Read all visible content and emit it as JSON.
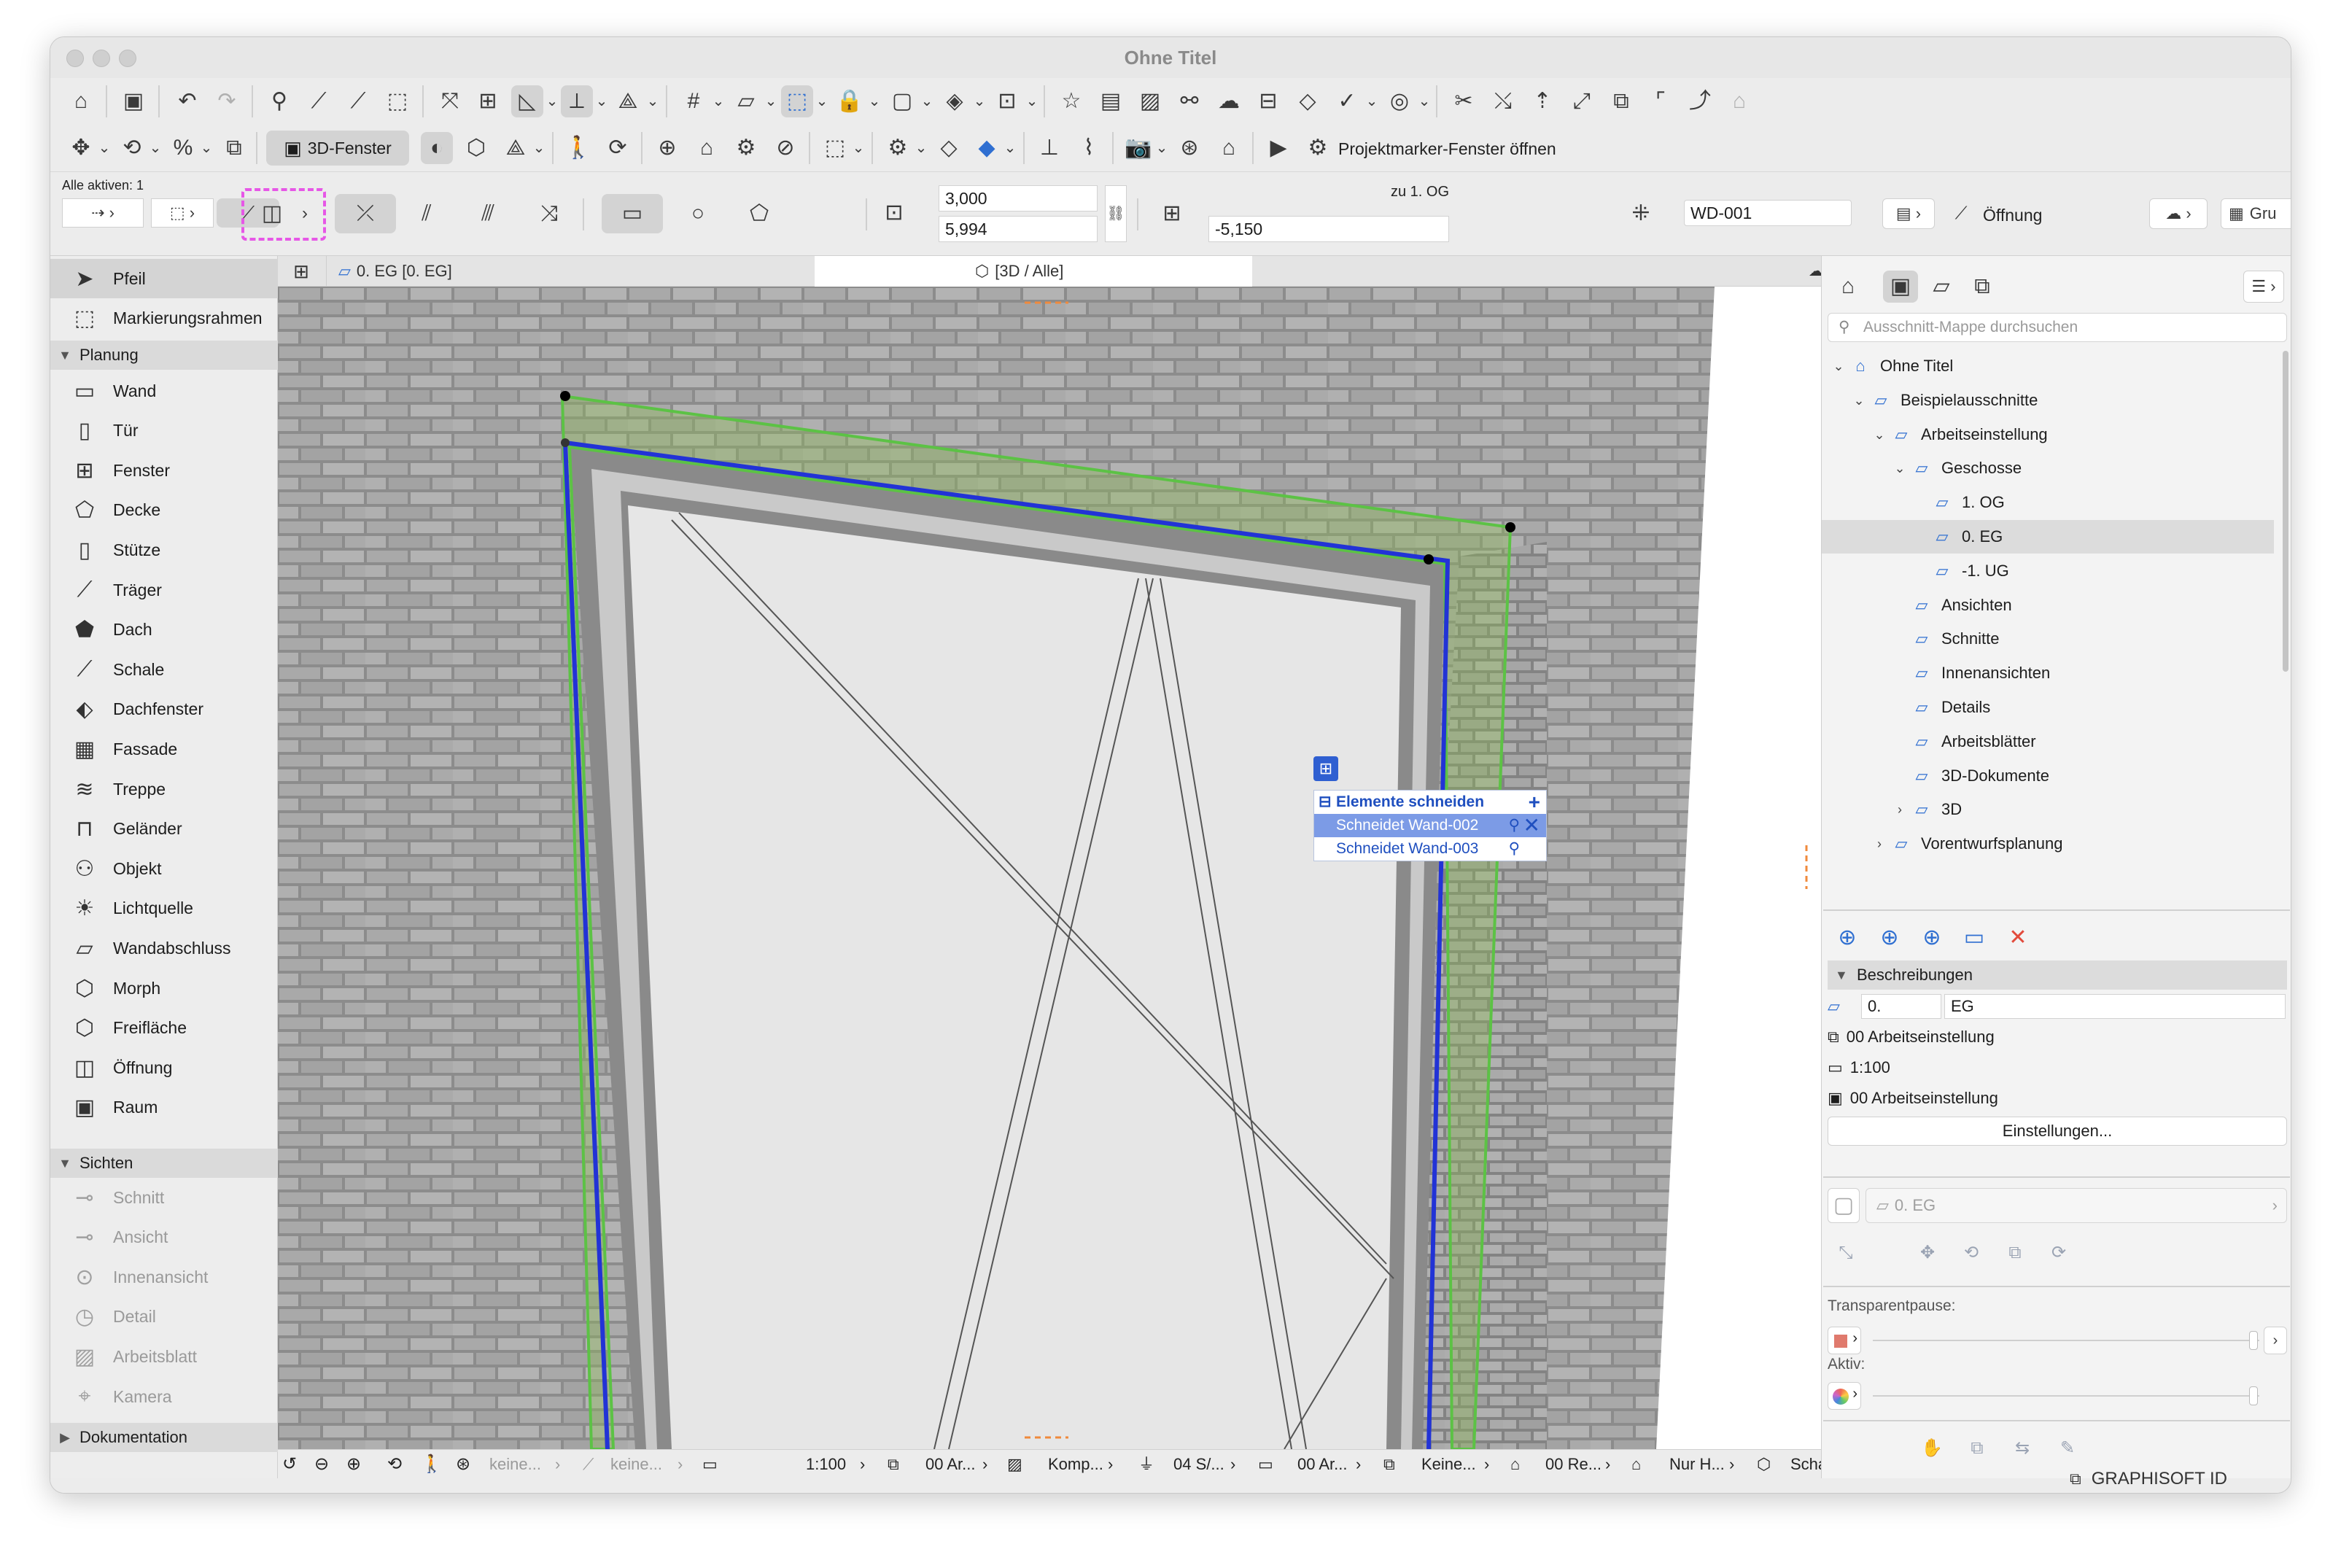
{
  "window": {
    "title": "Ohne Titel"
  },
  "toolbar2": {
    "window3d_label": "3D-Fenster",
    "marker_label": "Projektmarker-Fenster öffnen"
  },
  "infobox": {
    "all_active": "Alle aktiven: 1",
    "height1": "3,000",
    "height2": "5,994",
    "to_story": "zu 1. OG",
    "offset": "-5,150",
    "id": "WD-001",
    "element_type": "Öffnung",
    "group_label": "Gru"
  },
  "toolbox": {
    "top": [
      {
        "label": "Pfeil",
        "icon": "arrow-icon"
      },
      {
        "label": "Markierungsrahmen",
        "icon": "marquee-icon"
      }
    ],
    "sections": {
      "planung": "Planung",
      "sichten": "Sichten",
      "dokumentation": "Dokumentation"
    },
    "planung": [
      {
        "label": "Wand",
        "icon": "wall-icon"
      },
      {
        "label": "Tür",
        "icon": "door-icon"
      },
      {
        "label": "Fenster",
        "icon": "window-icon"
      },
      {
        "label": "Decke",
        "icon": "slab-icon"
      },
      {
        "label": "Stütze",
        "icon": "column-icon"
      },
      {
        "label": "Träger",
        "icon": "beam-icon"
      },
      {
        "label": "Dach",
        "icon": "roof-icon"
      },
      {
        "label": "Schale",
        "icon": "shell-icon"
      },
      {
        "label": "Dachfenster",
        "icon": "skylight-icon"
      },
      {
        "label": "Fassade",
        "icon": "curtainwall-icon"
      },
      {
        "label": "Treppe",
        "icon": "stair-icon"
      },
      {
        "label": "Geländer",
        "icon": "railing-icon"
      },
      {
        "label": "Objekt",
        "icon": "object-icon"
      },
      {
        "label": "Lichtquelle",
        "icon": "lamp-icon"
      },
      {
        "label": "Wandabschluss",
        "icon": "wallend-icon"
      },
      {
        "label": "Morph",
        "icon": "morph-icon"
      },
      {
        "label": "Freifläche",
        "icon": "mesh-icon"
      },
      {
        "label": "Öffnung",
        "icon": "opening-icon"
      },
      {
        "label": "Raum",
        "icon": "zone-icon"
      }
    ],
    "sichten": [
      {
        "label": "Schnitt",
        "icon": "section-icon"
      },
      {
        "label": "Ansicht",
        "icon": "elevation-icon"
      },
      {
        "label": "Innenansicht",
        "icon": "interior-elevation-icon"
      },
      {
        "label": "Detail",
        "icon": "detail-icon"
      },
      {
        "label": "Arbeitsblatt",
        "icon": "worksheet-icon"
      },
      {
        "label": "Kamera",
        "icon": "camera-icon"
      }
    ]
  },
  "tabs": [
    {
      "label": "0. EG [0. EG]"
    },
    {
      "label": "[3D / Alle]"
    }
  ],
  "cut_panel": {
    "title": "Elemente schneiden",
    "items": [
      "Schneidet Wand-002",
      "Schneidet Wand-003"
    ]
  },
  "statusbar": {
    "items": [
      "keine...",
      "keine...",
      "1:100",
      "00 Ar...",
      "Komp...",
      "04 S/...",
      "00 Ar...",
      "Keine...",
      "00 Re...",
      "Nur H...",
      "Schat..."
    ]
  },
  "navigator": {
    "search_placeholder": "Ausschnitt-Mappe durchsuchen",
    "tree": [
      {
        "label": "Ohne Titel",
        "level": 0,
        "chev": "⌄"
      },
      {
        "label": "Beispielausschnitte",
        "level": 1,
        "chev": "⌄"
      },
      {
        "label": "Arbeitseinstellung",
        "level": 2,
        "chev": "⌄"
      },
      {
        "label": "Geschosse",
        "level": 3,
        "chev": "⌄"
      },
      {
        "label": "1. OG",
        "level": 4,
        "chev": ""
      },
      {
        "label": "0. EG",
        "level": 4,
        "chev": "",
        "selected": true
      },
      {
        "label": "-1. UG",
        "level": 4,
        "chev": ""
      },
      {
        "label": "Ansichten",
        "level": 3,
        "chev": ""
      },
      {
        "label": "Schnitte",
        "level": 3,
        "chev": ""
      },
      {
        "label": "Innenansichten",
        "level": 3,
        "chev": ""
      },
      {
        "label": "Details",
        "level": 3,
        "chev": ""
      },
      {
        "label": "Arbeitsblätter",
        "level": 3,
        "chev": ""
      },
      {
        "label": "3D-Dokumente",
        "level": 3,
        "chev": ""
      },
      {
        "label": "3D",
        "level": 3,
        "chev": "›"
      },
      {
        "label": "Vorentwurfsplanung",
        "level": 2,
        "chev": "›"
      }
    ],
    "descriptions_title": "Beschreibungen",
    "story_number": "0.",
    "story_name": "EG",
    "layer_combo": "00 Arbeitseinstellung",
    "scale": "1:100",
    "model_view": "00 Arbeitseinstellung",
    "settings_button": "Einstellungen...",
    "story_display": "0. EG",
    "transparent_label": "Transparentpause:",
    "active_label": "Aktiv:"
  },
  "footer": {
    "brand": "GRAPHISOFT ID"
  },
  "colors": {
    "highlight": "#e657e6",
    "selection_blue": "#1f4fbf",
    "green_outline": "#5cc245"
  }
}
